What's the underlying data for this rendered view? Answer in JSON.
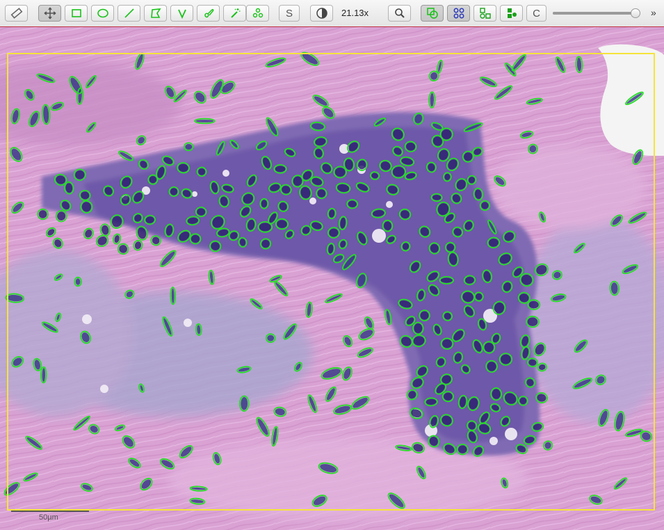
{
  "toolbar": {
    "tools": [
      {
        "name": "ruler-tool-button",
        "icon": "ruler-icon",
        "active": false
      },
      {
        "name": "pan-tool-button",
        "icon": "move-icon",
        "active": true
      },
      {
        "name": "rectangle-tool-button",
        "icon": "rectangle-icon",
        "active": false
      },
      {
        "name": "ellipse-tool-button",
        "icon": "ellipse-icon",
        "active": false
      },
      {
        "name": "line-tool-button",
        "icon": "line-icon",
        "active": false
      },
      {
        "name": "polygon-tool-button",
        "icon": "polygon-icon",
        "active": false
      },
      {
        "name": "polyline-tool-button",
        "icon": "polyline-v-icon",
        "active": false
      },
      {
        "name": "brush-tool-button",
        "icon": "brush-icon",
        "active": false
      },
      {
        "name": "wand-tool-button",
        "icon": "magic-wand-icon",
        "active": false
      },
      {
        "name": "points-tool-button",
        "icon": "points-icon",
        "active": false
      }
    ],
    "selection_label": "S",
    "zoom_text": "21.13x",
    "compare_label": "C",
    "slider_value": 1.0,
    "overflow_label": "»"
  },
  "viewer": {
    "scale_label": "50µm",
    "annotation_color": "#22e022",
    "roi_color": "#f5e43a"
  }
}
